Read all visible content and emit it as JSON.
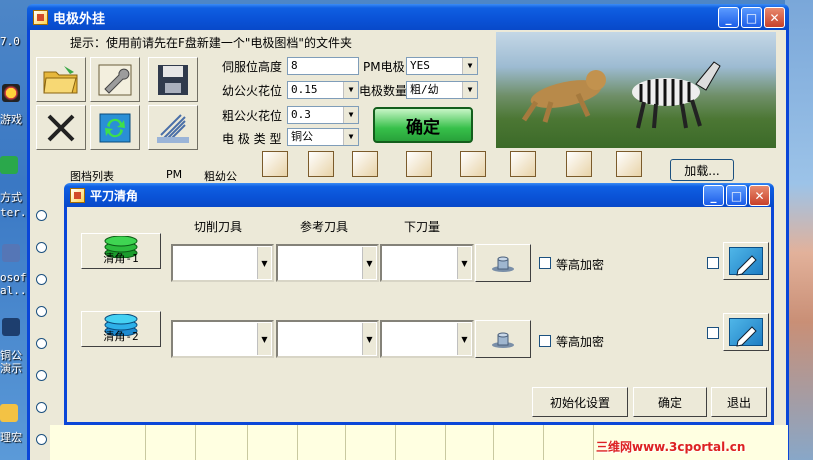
{
  "desktop": {
    "labels": [
      "7.0",
      "游戏",
      "方式",
      "ter.",
      "osof",
      "al...",
      "铜公",
      "演示",
      "理宏"
    ]
  },
  "main_window": {
    "title": "电极外挂",
    "hint": "提示：使用前请先在F盘新建一个\"电极图档\"的文件夹",
    "form": {
      "servo_height_label": "伺服位高度",
      "servo_height_value": "8",
      "pm_electrode_label": "PM电极",
      "pm_electrode_value": "YES",
      "fine_spark_label": "幼公火花位",
      "fine_spark_value": "0.15",
      "electrode_count_label": "电极数量",
      "electrode_count_value": "粗/幼",
      "rough_spark_label": "粗公火花位",
      "rough_spark_value": "0.3",
      "electrode_type_label": "电 极 类 型",
      "electrode_type_value": "铜公",
      "confirm_label": "确定"
    },
    "tabs": [
      "图档列表",
      "PM",
      "粗幼公"
    ],
    "load_label": "加载..."
  },
  "dialog": {
    "title": "平刀清角",
    "headers": {
      "cut_tool": "切削刀具",
      "ref_tool": "参考刀具",
      "feed": "下刀量"
    },
    "rows": [
      {
        "button": "清角-1",
        "contour_label": "等高加密"
      },
      {
        "button": "清角-2",
        "contour_label": "等高加密"
      }
    ],
    "buttons": {
      "init": "初始化设置",
      "ok": "确定",
      "exit": "退出"
    }
  },
  "watermark": "三维网www.3cportal.cn",
  "colors": {
    "title_blue": "#0a52d6",
    "window_bg": "#ece9d8",
    "ok_green": "#37c04a"
  }
}
